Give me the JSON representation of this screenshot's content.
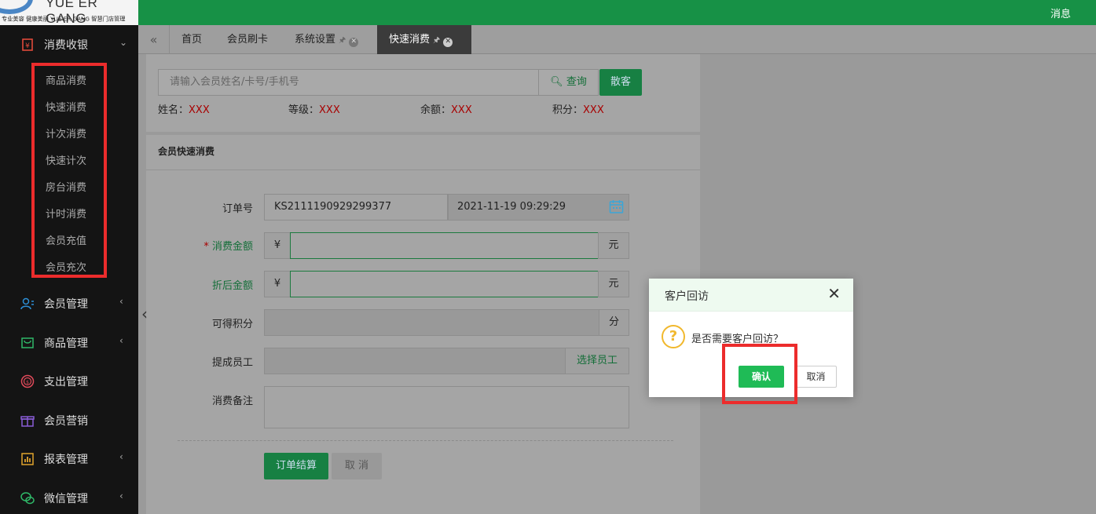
{
  "header": {
    "logo_text": "YUE ER GANG",
    "logo_sub": "专业美容 健康美丽 YUE ER GANG 智慧门店管理",
    "messages_label": "消息"
  },
  "sidebar": {
    "sections": [
      {
        "label": "消费收银",
        "icon": "cashier-icon",
        "arrow": "⌄"
      },
      {
        "label": "会员管理",
        "icon": "members-icon",
        "arrow": "‹"
      },
      {
        "label": "商品管理",
        "icon": "goods-icon",
        "arrow": "‹"
      },
      {
        "label": "支出管理",
        "icon": "expense-icon",
        "arrow": ""
      },
      {
        "label": "会员营销",
        "icon": "gift-icon",
        "arrow": ""
      },
      {
        "label": "报表管理",
        "icon": "report-icon",
        "arrow": "‹"
      },
      {
        "label": "微信管理",
        "icon": "wechat-icon",
        "arrow": "‹"
      }
    ],
    "sub_items": [
      "商品消费",
      "快速消费",
      "计次消费",
      "快速计次",
      "房台消费",
      "计时消费",
      "会员充值",
      "会员充次"
    ]
  },
  "tabs": [
    {
      "label": "首页"
    },
    {
      "label": "会员刷卡"
    },
    {
      "label": "系统设置"
    },
    {
      "label": "快速消费"
    }
  ],
  "search": {
    "placeholder": "请输入会员姓名/卡号/手机号",
    "query_label": "查询",
    "walkin_label": "散客"
  },
  "member_info": {
    "name_label": "姓名：",
    "name": "XXX",
    "level_label": "等级：",
    "level": "XXX",
    "balance_label": "余额：",
    "balance": "XXX",
    "points_label": "积分：",
    "points": "XXX"
  },
  "form": {
    "section_title": "会员快速消费",
    "order_no_label": "订单号",
    "order_no": "KS2111190929299377",
    "datetime": "2021-11-19 09:29:29",
    "amount_label": "消费金额",
    "amount_star": "*",
    "currency": "¥",
    "unit_yuan": "元",
    "discount_label": "折后金额",
    "points_label": "可得积分",
    "unit_points": "分",
    "staff_label": "提成员工",
    "staff_button": "选择员工",
    "remark_label": "消费备注",
    "submit_label": "订单结算",
    "cancel_label": "取 消"
  },
  "modal": {
    "title": "客户回访",
    "message": "是否需要客户回访？",
    "ok_label": "确认",
    "cancel_label": "取消",
    "close_glyph": "✕"
  },
  "colors": {
    "topbar": "#179146",
    "sidebar": "#141414",
    "primary_green": "#1fbb56",
    "highlight_red": "#ec2c2c",
    "warning": "#f1b82d"
  }
}
